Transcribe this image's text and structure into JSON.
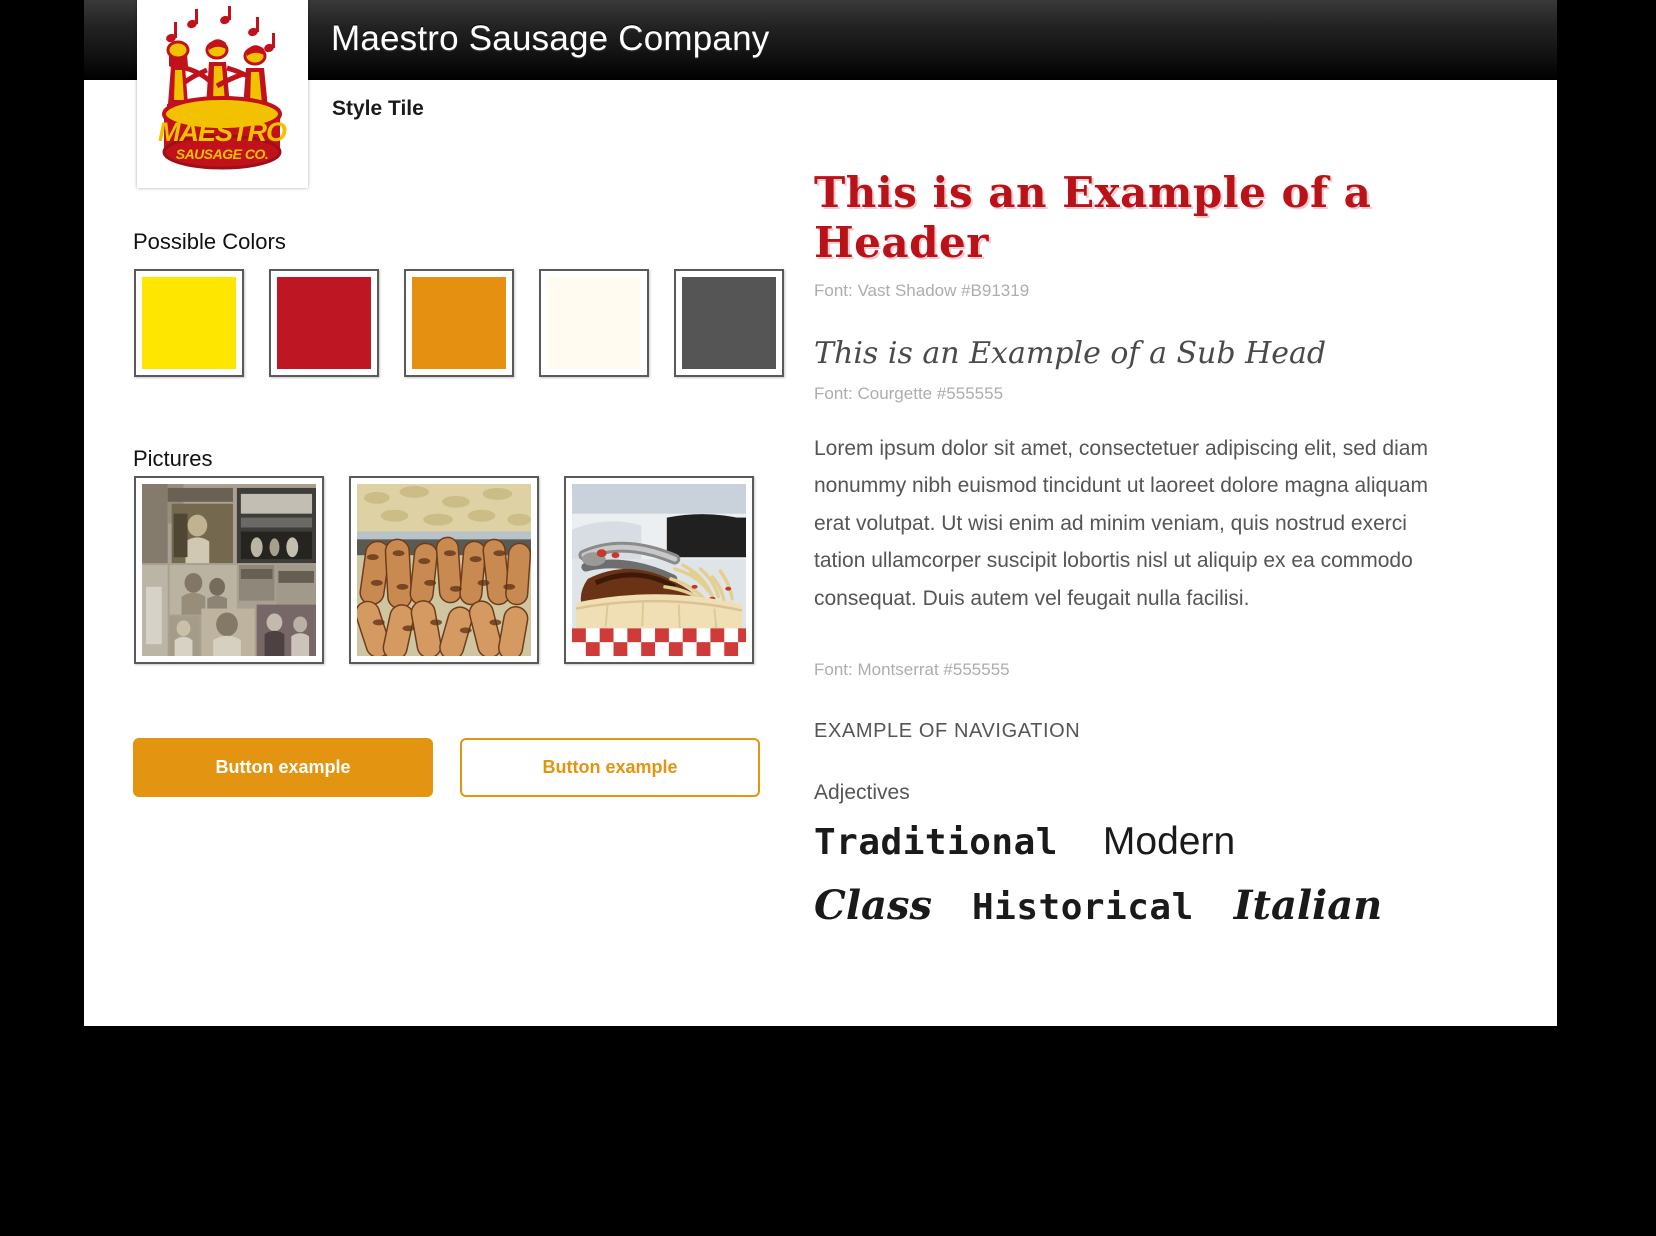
{
  "app": {
    "title": "Maestro Sausage Company",
    "page_label": "Style Tile"
  },
  "logo": {
    "name": "maestro-sausage-logo",
    "primary_text": "MAESTRO",
    "secondary_text": "SAUSAGE CO.",
    "red": "#C1121C",
    "yellow": "#F2C200"
  },
  "sections": {
    "colors_label": "Possible Colors",
    "pictures_label": "Pictures"
  },
  "swatches": [
    {
      "name": "yellow",
      "hex": "#FFE600"
    },
    {
      "name": "red",
      "hex": "#BE1622"
    },
    {
      "name": "orange",
      "hex": "#E59010"
    },
    {
      "name": "cream",
      "hex": "#FFFBF0"
    },
    {
      "name": "dark-gray",
      "hex": "#555555"
    }
  ],
  "pictures": [
    {
      "name": "vintage-photo-collage",
      "alt": "Sepia vintage photo collage of family and storefront"
    },
    {
      "name": "grilled-sausages",
      "alt": "Close-up of grilled sausages on a tray"
    },
    {
      "name": "sausage-sandwich",
      "alt": "Sausage sandwich with onions on a bun in checkered paper"
    }
  ],
  "buttons": {
    "filled_label": "Button example",
    "outline_label": "Button example",
    "accent": "#E39410"
  },
  "typography": {
    "headline": "This is an Example of a Header",
    "headline_note": "Font: Vast Shadow #B91319",
    "headline_color": "#B91319",
    "subhead": "This is an Example of a Sub Head",
    "subhead_note": "Font: Courgette #555555",
    "body": "Lorem ipsum dolor sit amet, consectetuer adipiscing elit, sed diam nonummy nibh euismod tincidunt ut laoreet dolore magna aliquam erat volutpat. Ut wisi enim ad minim veniam, quis nostrud exerci tation ullamcorper suscipit lobortis nisl ut aliquip ex ea commodo consequat. Duis autem vel feugait nulla facilisi.",
    "body_note": "Font: Montserrat #555555",
    "body_color": "#555555"
  },
  "navigation": {
    "example_label": "EXAMPLE OF NAVIGATION"
  },
  "adjectives": {
    "label": "Adjectives",
    "row1": [
      {
        "text": "Traditional",
        "style": "slab"
      },
      {
        "text": "Modern",
        "style": "sans"
      }
    ],
    "row2": [
      {
        "text": "Class",
        "style": "script"
      },
      {
        "text": "Historical",
        "style": "slab"
      },
      {
        "text": "Italian",
        "style": "script"
      }
    ]
  }
}
